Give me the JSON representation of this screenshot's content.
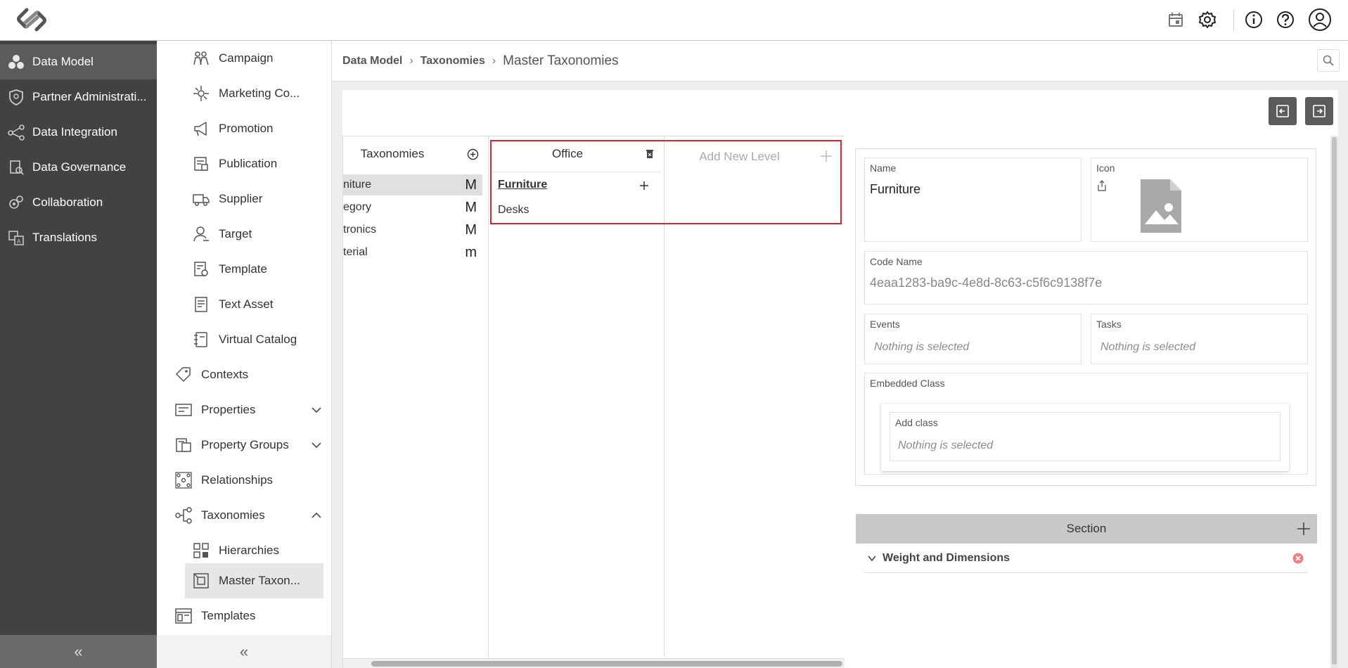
{
  "top_bar": {
    "icons": [
      "logo-icon",
      "calendar-icon",
      "gear-icon",
      "info-icon",
      "help-icon",
      "user-avatar-icon"
    ]
  },
  "left_nav": {
    "items": [
      {
        "label": "Data Model",
        "icon": "data-model-icon",
        "active": true
      },
      {
        "label": "Partner Administrati...",
        "icon": "shield-icon"
      },
      {
        "label": "Data Integration",
        "icon": "integration-icon"
      },
      {
        "label": "Data Governance",
        "icon": "governance-icon"
      },
      {
        "label": "Collaboration",
        "icon": "collaboration-icon"
      },
      {
        "label": "Translations",
        "icon": "translate-icon"
      }
    ],
    "collapse_label": "«"
  },
  "sub_nav": {
    "items": [
      {
        "label": "Campaign",
        "icon": "campaign-icon"
      },
      {
        "label": "Marketing Co...",
        "icon": "marketing-icon"
      },
      {
        "label": "Promotion",
        "icon": "megaphone-icon"
      },
      {
        "label": "Publication",
        "icon": "publication-icon"
      },
      {
        "label": "Supplier",
        "icon": "truck-icon"
      },
      {
        "label": "Target",
        "icon": "target-user-icon"
      },
      {
        "label": "Template",
        "icon": "template-doc-icon"
      },
      {
        "label": "Text Asset",
        "icon": "text-asset-icon"
      },
      {
        "label": "Virtual Catalog",
        "icon": "catalog-icon"
      },
      {
        "label": "Contexts",
        "icon": "tag-icon"
      },
      {
        "label": "Properties",
        "icon": "properties-icon"
      },
      {
        "label": "Property Groups",
        "icon": "property-groups-icon"
      },
      {
        "label": "Relationships",
        "icon": "relationships-icon"
      },
      {
        "label": "Taxonomies",
        "icon": "taxonomies-icon"
      },
      {
        "label": "Hierarchies",
        "icon": "hierarchies-icon"
      },
      {
        "label": "Master Taxon...",
        "icon": "master-taxonomy-icon",
        "active": true
      },
      {
        "label": "Templates",
        "icon": "templates-icon"
      }
    ],
    "collapse_label": "«"
  },
  "breadcrumb": {
    "items": [
      "Data Model",
      "Taxonomies"
    ],
    "separator": "›",
    "current": "Master Taxonomies"
  },
  "taxonomies_column": {
    "header": "Taxonomies",
    "rows": [
      {
        "label": "niture",
        "badge": "M",
        "selected": true
      },
      {
        "label": "egory",
        "badge": "M"
      },
      {
        "label": "tronics",
        "badge": "M"
      },
      {
        "label": "terial",
        "badge": "m"
      }
    ]
  },
  "level_column": {
    "header": "Office",
    "items": [
      {
        "label": "Furniture",
        "selected": true
      },
      {
        "label": "Desks"
      }
    ]
  },
  "new_level_column": {
    "header": "Add New Level"
  },
  "detail": {
    "name_label": "Name",
    "name_value": "Furniture",
    "icon_label": "Icon",
    "code_name_label": "Code Name",
    "code_name_value": "4eaa1283-ba9c-4e8d-8c63-c5f6c9138f7e",
    "events_label": "Events",
    "events_placeholder": "Nothing is selected",
    "tasks_label": "Tasks",
    "tasks_placeholder": "Nothing is selected",
    "embedded_class_label": "Embedded Class",
    "add_class_label": "Add class",
    "add_class_placeholder": "Nothing is selected",
    "section_label": "Section",
    "section_item": "Weight and Dimensions"
  },
  "colors": {
    "left_nav_bg": "#424242",
    "active_nav_bg": "#5b5b5b",
    "highlight_border": "#e0242b",
    "remove_icon": "#f08080"
  }
}
